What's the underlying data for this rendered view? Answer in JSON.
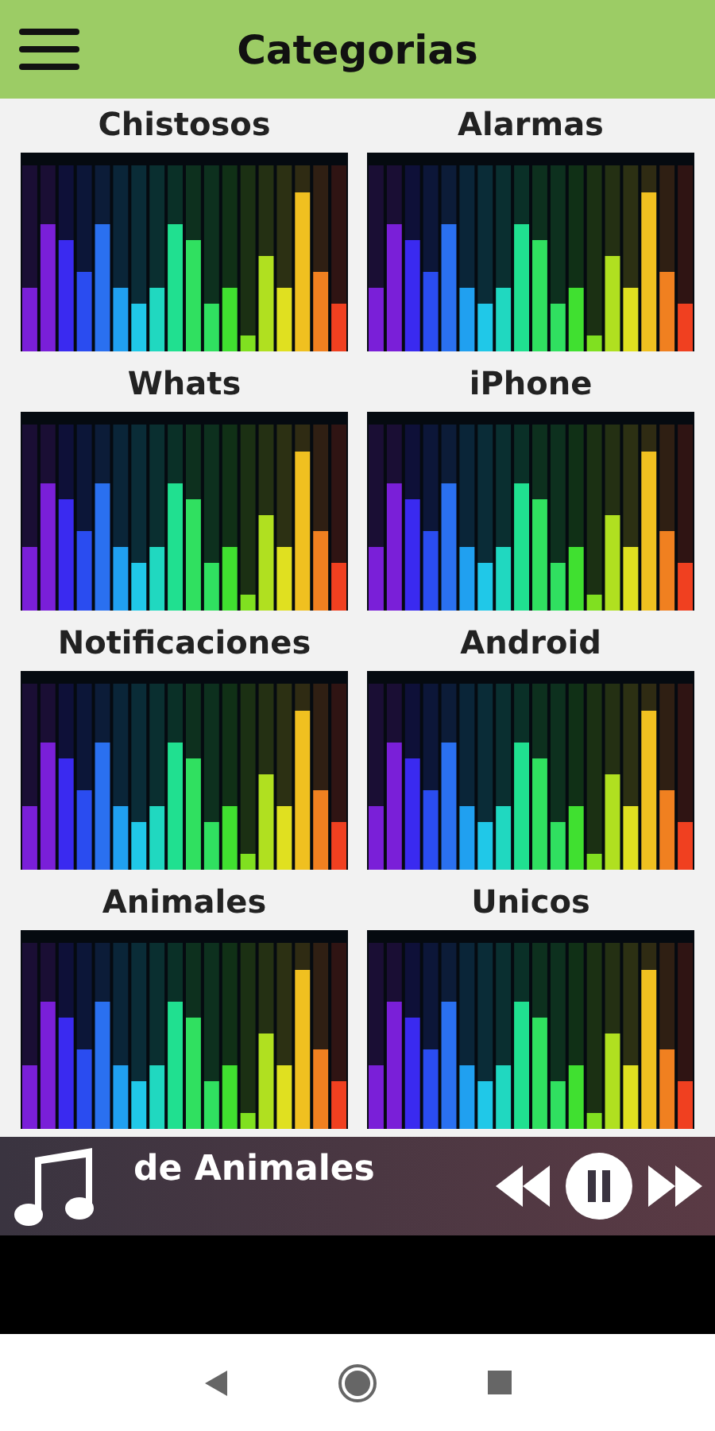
{
  "header": {
    "title": "Categorias"
  },
  "categories": [
    {
      "label": "Chistosos"
    },
    {
      "label": "Alarmas"
    },
    {
      "label": "Whats"
    },
    {
      "label": "iPhone"
    },
    {
      "label": "Notificaciones"
    },
    {
      "label": "Android"
    },
    {
      "label": "Animales"
    },
    {
      "label": "Unicos"
    }
  ],
  "player": {
    "track": "de Animales"
  }
}
